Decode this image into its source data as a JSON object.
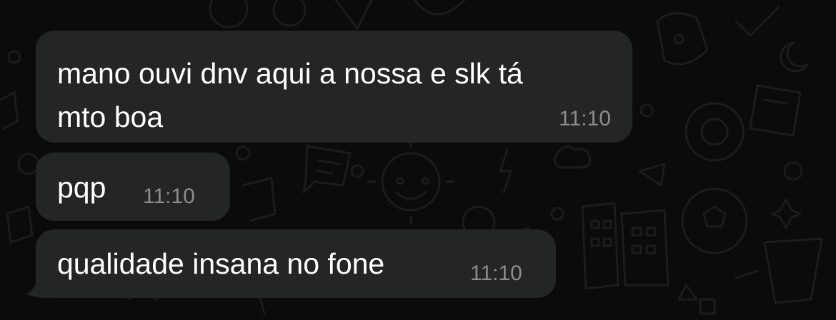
{
  "theme": {
    "background": "#0b0b0b",
    "bubble_color": "#242626",
    "text_color": "#ffffff",
    "time_color": "#8b8d8e"
  },
  "messages": [
    {
      "line1": "mano ouvi dnv aqui a nossa e slk tá",
      "line2": "mto boa",
      "time": "11:10"
    },
    {
      "text": "pqp",
      "time": "11:10"
    },
    {
      "text": "qualidade insana no fone",
      "time": "11:10"
    }
  ],
  "icons": {
    "wallpaper": "chat-doodle-wallpaper",
    "tail": "bubble-tail"
  }
}
